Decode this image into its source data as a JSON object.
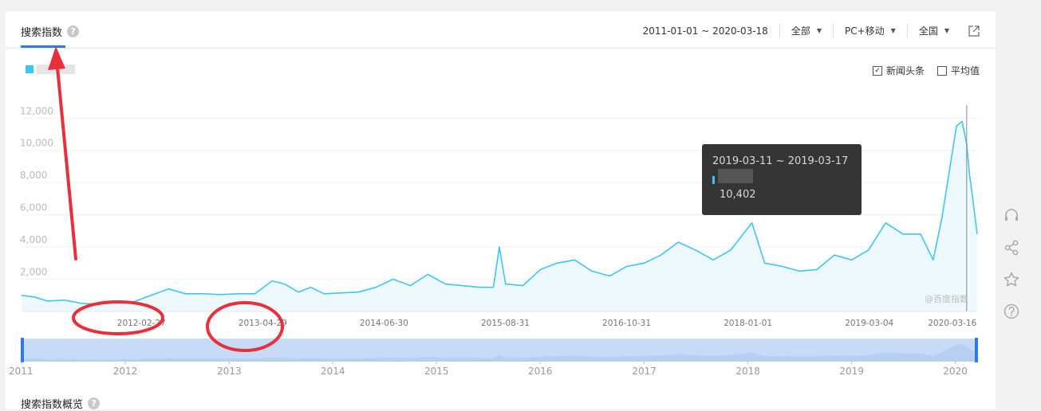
{
  "tab": {
    "title": "搜索指数",
    "help": "?"
  },
  "filters": {
    "date_range": "2011-01-01 ~ 2020-03-18",
    "region_type": "全部",
    "device": "PC+移动",
    "area": "全国"
  },
  "options": {
    "news_headline": {
      "label": "新闻头条",
      "checked": true
    },
    "average": {
      "label": "平均值",
      "checked": false
    }
  },
  "tooltip": {
    "range": "2019-03-11 ~ 2019-03-17",
    "value": "10,402"
  },
  "watermark": "@百度指数",
  "overview_title": "搜索指数概览",
  "colors": {
    "series": "#3ec6f2",
    "accent": "#2e7ae6",
    "annotation": "#e8303a"
  },
  "chart_data": {
    "type": "area",
    "ylim": [
      0,
      12000
    ],
    "y_ticks": [
      {
        "value": 2000,
        "label": "2,000"
      },
      {
        "value": 4000,
        "label": "4,000"
      },
      {
        "value": 6000,
        "label": "6,000"
      },
      {
        "value": 8000,
        "label": "8,000"
      },
      {
        "value": 10000,
        "label": "10,000"
      },
      {
        "value": 12000,
        "label": "12,000"
      }
    ],
    "x_range": [
      "2011-01-01",
      "2020-03-18"
    ],
    "x_tick_labels": [
      {
        "date": "2012-02-27",
        "label": "2012-02-27"
      },
      {
        "date": "2013-04-29",
        "label": "2013-04-29"
      },
      {
        "date": "2014-06-30",
        "label": "2014-06-30"
      },
      {
        "date": "2015-08-31",
        "label": "2015-08-31"
      },
      {
        "date": "2016-10-31",
        "label": "2016-10-31"
      },
      {
        "date": "2018-01-01",
        "label": "2018-01-01"
      },
      {
        "date": "2019-03-04",
        "label": "2019-03-04"
      },
      {
        "date": "2020-03-16",
        "label": "2020-03-16"
      }
    ],
    "series": [
      {
        "points": [
          [
            "2011-01-01",
            1000
          ],
          [
            "2011-02-15",
            900
          ],
          [
            "2011-04-01",
            650
          ],
          [
            "2011-06-01",
            700
          ],
          [
            "2011-08-01",
            500
          ],
          [
            "2011-10-01",
            450
          ],
          [
            "2011-12-01",
            550
          ],
          [
            "2012-02-01",
            600
          ],
          [
            "2012-04-01",
            1000
          ],
          [
            "2012-06-01",
            1400
          ],
          [
            "2012-08-01",
            1100
          ],
          [
            "2012-10-01",
            1100
          ],
          [
            "2012-12-01",
            1050
          ],
          [
            "2013-02-01",
            1100
          ],
          [
            "2013-04-01",
            1100
          ],
          [
            "2013-06-01",
            1900
          ],
          [
            "2013-07-15",
            1700
          ],
          [
            "2013-09-01",
            1200
          ],
          [
            "2013-10-15",
            1500
          ],
          [
            "2013-12-01",
            1100
          ],
          [
            "2014-02-01",
            1150
          ],
          [
            "2014-04-01",
            1200
          ],
          [
            "2014-06-01",
            1500
          ],
          [
            "2014-08-01",
            2000
          ],
          [
            "2014-10-01",
            1600
          ],
          [
            "2014-12-01",
            2300
          ],
          [
            "2015-02-01",
            1700
          ],
          [
            "2015-04-01",
            1600
          ],
          [
            "2015-06-01",
            1500
          ],
          [
            "2015-07-20",
            1500
          ],
          [
            "2015-08-10",
            4000
          ],
          [
            "2015-09-01",
            1700
          ],
          [
            "2015-11-01",
            1600
          ],
          [
            "2016-01-01",
            2600
          ],
          [
            "2016-03-01",
            3000
          ],
          [
            "2016-05-01",
            3200
          ],
          [
            "2016-07-01",
            2500
          ],
          [
            "2016-09-01",
            2200
          ],
          [
            "2016-11-01",
            2800
          ],
          [
            "2017-01-01",
            3000
          ],
          [
            "2017-03-01",
            3500
          ],
          [
            "2017-05-01",
            4300
          ],
          [
            "2017-07-01",
            3800
          ],
          [
            "2017-09-01",
            3200
          ],
          [
            "2017-11-01",
            3800
          ],
          [
            "2018-01-15",
            5500
          ],
          [
            "2018-03-01",
            3000
          ],
          [
            "2018-05-01",
            2800
          ],
          [
            "2018-07-01",
            2500
          ],
          [
            "2018-09-01",
            2600
          ],
          [
            "2018-11-01",
            3500
          ],
          [
            "2019-01-01",
            3200
          ],
          [
            "2019-03-01",
            3800
          ],
          [
            "2019-05-01",
            5500
          ],
          [
            "2019-07-01",
            4800
          ],
          [
            "2019-09-01",
            4800
          ],
          [
            "2019-10-15",
            3200
          ],
          [
            "2019-11-15",
            5800
          ],
          [
            "2020-01-05",
            11500
          ],
          [
            "2020-01-25",
            11800
          ],
          [
            "2020-02-10",
            10402
          ],
          [
            "2020-02-20",
            8500
          ],
          [
            "2020-03-01",
            7200
          ],
          [
            "2020-03-18",
            4800
          ]
        ]
      }
    ]
  },
  "navigator": {
    "years": [
      "2011",
      "2012",
      "2013",
      "2014",
      "2015",
      "2016",
      "2017",
      "2018",
      "2019",
      "2020"
    ]
  }
}
